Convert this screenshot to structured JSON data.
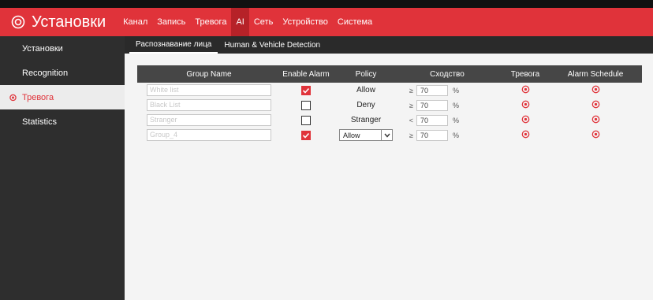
{
  "app": {
    "title": "Установки"
  },
  "nav": [
    {
      "label": "Канал",
      "active": false
    },
    {
      "label": "Запись",
      "active": false
    },
    {
      "label": "Тревога",
      "active": false
    },
    {
      "label": "AI",
      "active": true
    },
    {
      "label": "Сеть",
      "active": false
    },
    {
      "label": "Устройство",
      "active": false
    },
    {
      "label": "Система",
      "active": false
    }
  ],
  "sidebar": {
    "items": [
      {
        "label": "Установки",
        "active": false
      },
      {
        "label": "Recognition",
        "active": false
      },
      {
        "label": "Тревога",
        "active": true
      },
      {
        "label": "Statistics",
        "active": false
      }
    ]
  },
  "subtabs": [
    {
      "label": "Распознавание лица",
      "active": true
    },
    {
      "label": "Human & Vehicle Detection",
      "active": false
    }
  ],
  "table": {
    "headers": {
      "group_name": "Group Name",
      "enable_alarm": "Enable Alarm",
      "policy": "Policy",
      "similarity": "Сходство",
      "alarm": "Тревога",
      "schedule": "Alarm Schedule"
    },
    "rows": [
      {
        "name": "White list",
        "enabled": true,
        "policy": "Allow",
        "policy_is_select": false,
        "op": "≥",
        "similarity": "70",
        "unit": "%"
      },
      {
        "name": "Black List",
        "enabled": false,
        "policy": "Deny",
        "policy_is_select": false,
        "op": "≥",
        "similarity": "70",
        "unit": "%"
      },
      {
        "name": "Stranger",
        "enabled": false,
        "policy": "Stranger",
        "policy_is_select": false,
        "op": "<",
        "similarity": "70",
        "unit": "%"
      },
      {
        "name": "Group_4",
        "enabled": true,
        "policy": "Allow",
        "policy_is_select": true,
        "op": "≥",
        "similarity": "70",
        "unit": "%"
      }
    ]
  },
  "colors": {
    "accent": "#e0333a",
    "sidebar_bg": "#2e2e2e",
    "header_row_bg": "#464646"
  },
  "icons": {
    "logo": "settings-gear-icon",
    "alarm_setting": "gear-icon",
    "schedule_setting": "gear-icon",
    "dropdown": "chevron-down-icon",
    "check": "checkmark-icon"
  }
}
